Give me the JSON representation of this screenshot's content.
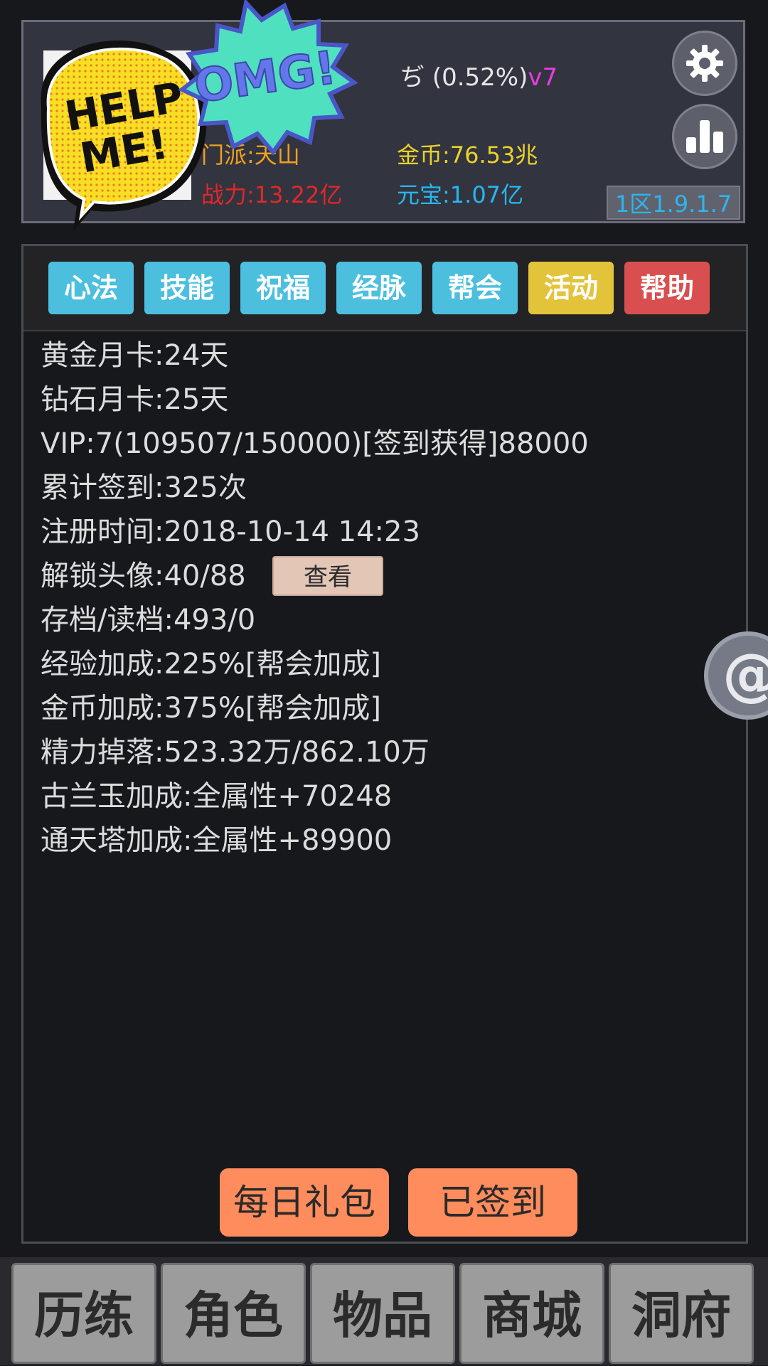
{
  "header": {
    "name_tail": "ぢ",
    "progress": "(0.52%)",
    "vip_level": "v7",
    "sect_label": "门派:天山",
    "power_label": "战力:13.22亿",
    "gold_label": "金币:76.53兆",
    "ingot_label": "元宝:1.07亿",
    "server": "1区1.9.1.7",
    "sticker_help": "HELP",
    "sticker_me": "ME!",
    "sticker_omg": "OMG!"
  },
  "tabs": [
    "心法",
    "技能",
    "祝福",
    "经脉",
    "帮会",
    "活动",
    "帮助"
  ],
  "info": [
    "黄金月卡:24天",
    "钻石月卡:25天",
    "VIP:7(109507/150000)[签到获得]88000",
    "累计签到:325次",
    "注册时间:2018-10-14 14:23",
    "解锁头像:40/88",
    "存档/读档:493/0",
    "经验加成:225%[帮会加成]",
    "金币加成:375%[帮会加成]",
    "精力掉落:523.32万/862.10万",
    "古兰玉加成:全属性+70248",
    "通天塔加成:全属性+89900"
  ],
  "view_button": "查看",
  "actions": {
    "daily_gift": "每日礼包",
    "signed_in": "已签到"
  },
  "floating_icon": "@",
  "nav": [
    "历练",
    "角色",
    "物品",
    "商城",
    "洞府"
  ]
}
